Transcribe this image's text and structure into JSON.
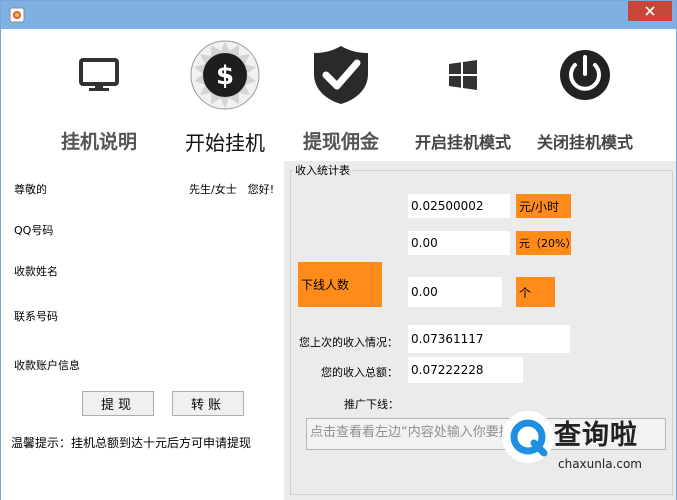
{
  "colors": {
    "titlebar": "#7fb0e4",
    "close": "#c7463a",
    "accent_orange": "#ff8c1a",
    "panel_bg": "#ebebeb"
  },
  "toolbar": {
    "items": [
      {
        "label": "挂机说明",
        "icon": "monitor-icon"
      },
      {
        "label": "开始挂机",
        "icon": "dollar-coin-icon"
      },
      {
        "label": "提现佣金",
        "icon": "shield-check-icon"
      },
      {
        "label": "开启挂机模式",
        "icon": "windows-logo-icon"
      },
      {
        "label": "关闭挂机模式",
        "icon": "power-icon"
      }
    ]
  },
  "left": {
    "greeting": "尊敬的",
    "salutation": "先生/女士　您好!",
    "qq_label": "QQ号码",
    "payee_name_label": "收款姓名",
    "phone_label": "联系号码",
    "account_label": "收款账户信息",
    "withdraw_button": "提现",
    "transfer_button": "转账",
    "tip": "温馨提示：挂机总额到达十元后方可申请提现"
  },
  "stats": {
    "group_title": "收入统计表",
    "rate_value": "0.02500002",
    "rate_unit": "元/小时",
    "share_value": "0.00",
    "share_unit": "元（20%）",
    "downline_label": "下线人数",
    "downline_value": "0.00",
    "downline_unit": "个",
    "last_income_label": "您上次的收入情况：",
    "last_income_value": "0.07361117",
    "total_income_label": "您的收入总额：",
    "total_income_value": "0.07222228",
    "promote_label": "推广下线：",
    "promote_placeholder": "点击查看看左边“内容处输入你要推"
  },
  "watermark": {
    "brand": "查询啦",
    "domain": "chaxunla.com"
  }
}
